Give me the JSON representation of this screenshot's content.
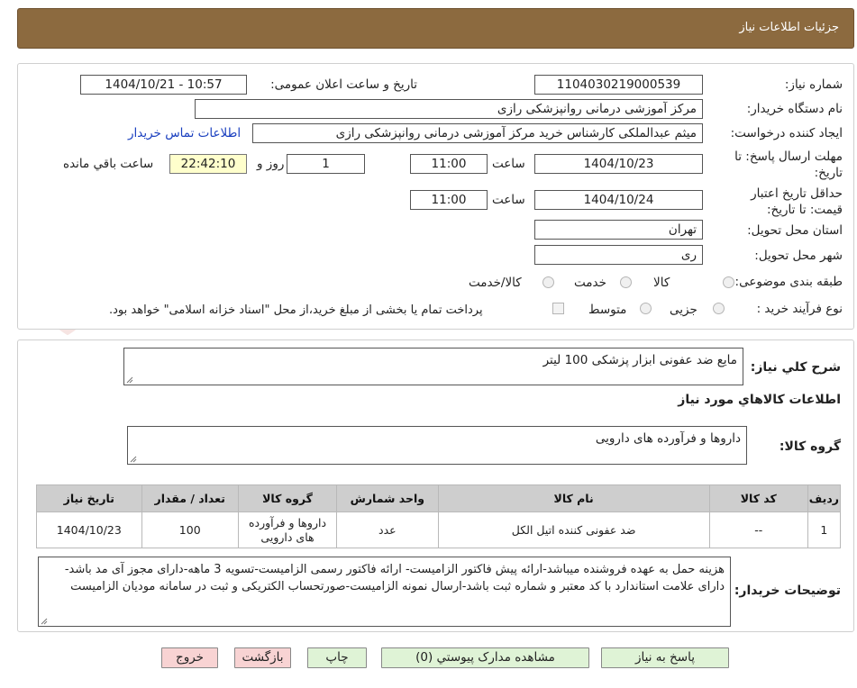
{
  "header": {
    "title": "جزئیات اطلاعات نیاز"
  },
  "fields": {
    "need_number_label": "شماره نیاز:",
    "need_number": "1104030219000539",
    "announce_label": "تاریخ و ساعت اعلان عمومی:",
    "announce_value": "1404/10/21 - 10:57",
    "buyer_org_label": "نام دستگاه خریدار:",
    "buyer_org": "مرکز آموزشی درمانی روانپزشکی رازی",
    "creator_label": "ایجاد کننده درخواست:",
    "creator": "میثم عبدالملکی کارشناس خرید مرکز آموزشی درمانی روانپزشکی رازی",
    "contact_link": "اطلاعات تماس خریدار",
    "deadline_label_1": "مهلت ارسال پاسخ: تا",
    "deadline_label_2": "تاریخ:",
    "deadline_date": "1404/10/23",
    "time_word": "ساعت",
    "deadline_time": "11:00",
    "days_count": "1",
    "days_word": "روز و",
    "remaining_time": "22:42:10",
    "remaining_word": "ساعت باقي مانده",
    "validity_label_1": "حداقل تاریخ اعتبار",
    "validity_label_2": "قیمت: تا تاریخ:",
    "validity_date": "1404/10/24",
    "validity_time": "11:00",
    "province_label": "استان محل تحویل:",
    "province": "تهران",
    "city_label": "شهر محل تحویل:",
    "city": "ری",
    "category_label": "طبقه بندی موضوعی:",
    "category_options": [
      "کالا",
      "خدمت",
      "کالا/خدمت"
    ],
    "process_label": "نوع فرآیند خرید :",
    "process_options": [
      "جزیی",
      "متوسط"
    ],
    "payment_note": "پرداخت تمام یا بخشی از مبلغ خرید،از محل \"اسناد خزانه اسلامی\" خواهد بود."
  },
  "summary": {
    "label": "شرح کلي نياز:",
    "value": "مایع ضد عفونی ابزار پزشکی 100 لیتر"
  },
  "goods_info_title": "اطلاعات کالاهاي مورد نياز",
  "goods_group": {
    "label": "گروه کالا:",
    "value": "داروها و فرآورده های دارویی"
  },
  "table": {
    "headers": [
      "ردیف",
      "کد کالا",
      "نام کالا",
      "واحد شمارش",
      "گروه کالا",
      "تعداد / مقدار",
      "تاریخ نیاز"
    ],
    "rows": [
      {
        "row": "1",
        "code": "--",
        "name": "ضد عفونی کننده اتیل الکل",
        "unit": "عدد",
        "group": "داروها و فرآورده های دارویی",
        "qty": "100",
        "date": "1404/10/23"
      }
    ]
  },
  "buyer_notes": {
    "label": "توضیحات خریدار:",
    "value": "هزینه حمل به عهده فروشنده میباشد-ارائه پیش فاکتور الزامیست- ارائه فاکتور رسمی الزامیست-تسویه 3 ماهه-دارای مجوز آی مد باشد-دارای علامت استاندارد با کد معتبر و شماره ثبت باشد-ارسال نمونه الزامیست-صورتحساب الکتریکی و ثبت در سامانه مودیان الزامیست"
  },
  "buttons": {
    "reply": "پاسخ به نیاز",
    "attachments": "مشاهده مدارک پیوستي (0)",
    "print": "چاپ",
    "back": "بازگشت",
    "exit": "خروج"
  },
  "colors": {
    "header_bg": "#8c6a3f",
    "green_button": "#dff3d6",
    "pink_button": "#f8d3d3",
    "remaining_bg": "#ffffcc",
    "link": "#1a3fbf"
  }
}
